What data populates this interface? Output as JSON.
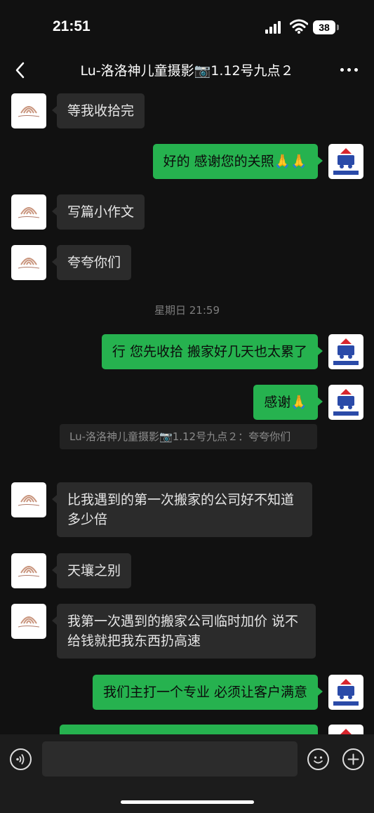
{
  "status": {
    "time": "21:51",
    "battery": "38"
  },
  "header": {
    "title": "Lu-洛洛神儿童摄影📷1.12号九点２"
  },
  "messages": [
    {
      "side": "in",
      "text": "等我收拾完"
    },
    {
      "side": "out",
      "text": "好的  感谢您的关照🙏🙏"
    },
    {
      "side": "in",
      "text": "写篇小作文"
    },
    {
      "side": "in",
      "text": "夸夸你们"
    },
    {
      "side": "out",
      "text": "行  您先收拾  搬家好几天也太累了"
    },
    {
      "side": "out",
      "text": "感谢🙏"
    },
    {
      "side": "in",
      "text": "比我遇到的第一次搬家的公司好不知道多少倍"
    },
    {
      "side": "in",
      "text": "天壤之别"
    },
    {
      "side": "in",
      "text": "我第一次遇到的搬家公司临时加价 说不给钱就把我东西扔高速"
    },
    {
      "side": "out",
      "text": "我们主打一个专业  必须让客户满意"
    }
  ],
  "timestamp": "星期日 21:59",
  "quote": "Lu-洛洛神儿童摄影📷1.12号九点２：夸夸你们",
  "colors": {
    "background": "#111111",
    "outgoing_bubble": "#26b24f",
    "incoming_bubble": "#2b2b2b"
  },
  "icons": {
    "back": "chevron-left-icon",
    "more": "more-dots-icon",
    "voice": "voice-icon",
    "emoji": "emoji-icon",
    "plus": "plus-icon"
  }
}
